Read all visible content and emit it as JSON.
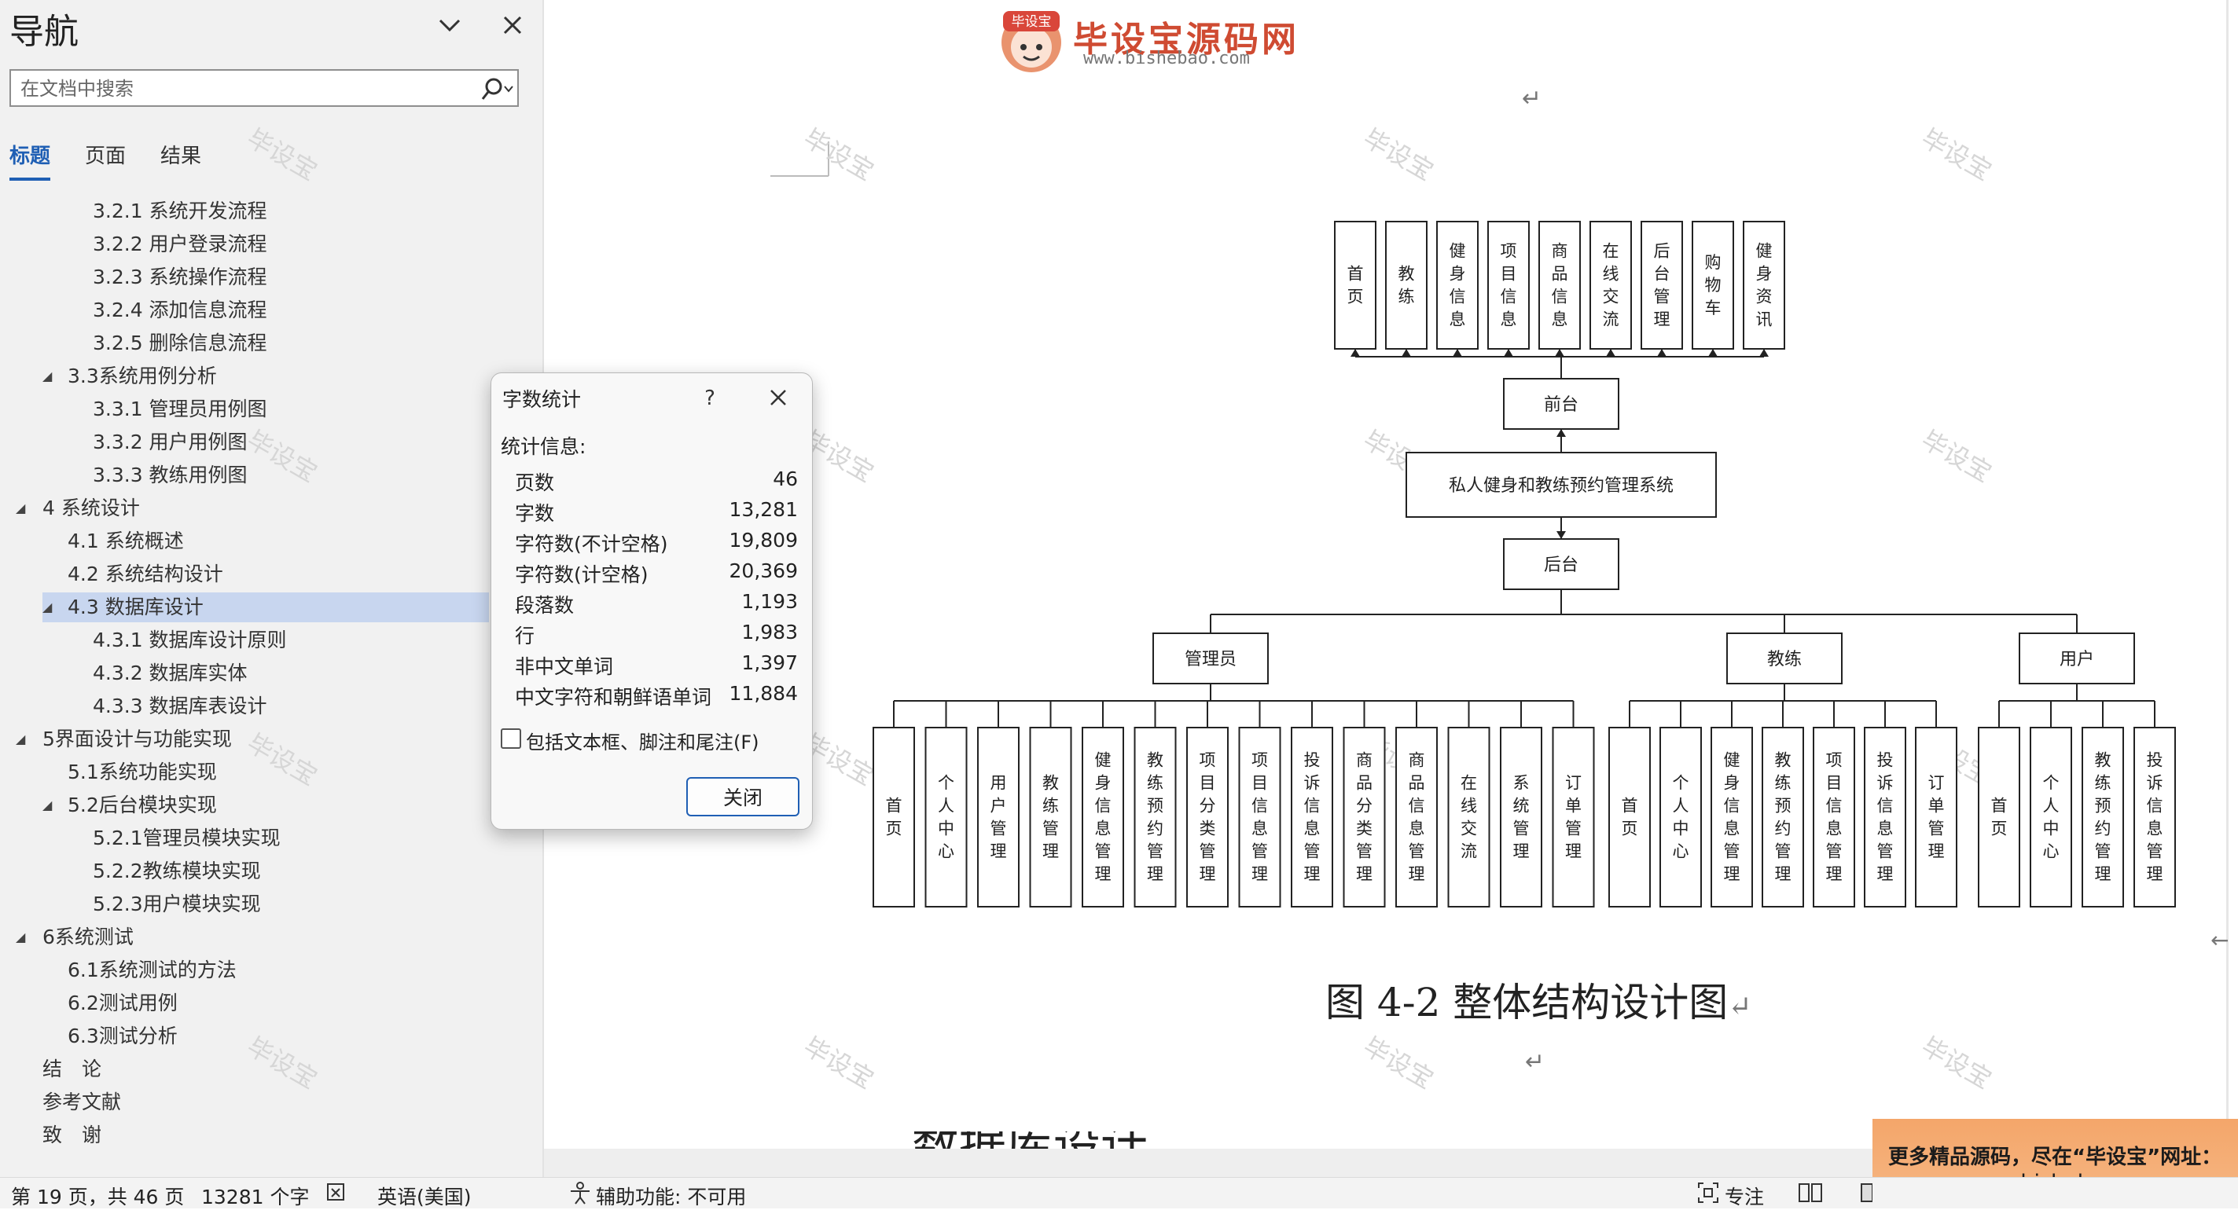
{
  "nav": {
    "title": "导航",
    "search_placeholder": "在文档中搜索",
    "tabs": [
      "标题",
      "页面",
      "结果"
    ],
    "tree": [
      {
        "label": "3.2.1 系统开发流程"
      },
      {
        "label": "3.2.2 用户登录流程"
      },
      {
        "label": "3.2.3 系统操作流程"
      },
      {
        "label": "3.2.4 添加信息流程"
      },
      {
        "label": "3.2.5 删除信息流程"
      },
      {
        "label": "3.3系统用例分析"
      },
      {
        "label": "3.3.1 管理员用例图"
      },
      {
        "label": "3.3.2 用户用例图"
      },
      {
        "label": "3.3.3 教练用例图"
      },
      {
        "label": "4 系统设计"
      },
      {
        "label": "4.1 系统概述"
      },
      {
        "label": "4.2 系统结构设计"
      },
      {
        "label": "4.3 数据库设计"
      },
      {
        "label": "4.3.1 数据库设计原则"
      },
      {
        "label": "4.3.2 数据库实体"
      },
      {
        "label": "4.3.3 数据库表设计"
      },
      {
        "label": "5界面设计与功能实现"
      },
      {
        "label": "5.1系统功能实现"
      },
      {
        "label": "5.2后台模块实现"
      },
      {
        "label": "5.2.1管理员模块实现"
      },
      {
        "label": "5.2.2教练模块实现"
      },
      {
        "label": "5.2.3用户模块实现"
      },
      {
        "label": "6系统测试"
      },
      {
        "label": "6.1系统测试的方法"
      },
      {
        "label": "6.2测试用例"
      },
      {
        "label": "6.3测试分析"
      },
      {
        "label": "结　论"
      },
      {
        "label": "参考文献"
      },
      {
        "label": "致　谢"
      }
    ]
  },
  "watermark": "毕设宝",
  "logo": {
    "name": "毕设宝源码网",
    "url": "www.bishebao.com",
    "badge": "毕设宝"
  },
  "dialog": {
    "title": "字数统计",
    "help": "?",
    "section": "统计信息:",
    "rows": [
      {
        "label": "页数",
        "value": "46"
      },
      {
        "label": "字数",
        "value": "13,281"
      },
      {
        "label": "字符数(不计空格)",
        "value": "19,809"
      },
      {
        "label": "字符数(计空格)",
        "value": "20,369"
      },
      {
        "label": "段落数",
        "value": "1,193"
      },
      {
        "label": "行",
        "value": "1,983"
      },
      {
        "label": "非中文单词",
        "value": "1,397"
      },
      {
        "label": "中文字符和朝鲜语单词",
        "value": "11,884"
      }
    ],
    "checkbox_label": "包括文本框、脚注和尾注(F)",
    "checkbox_checked": false,
    "close_label": "关闭"
  },
  "diagram": {
    "top_modules": [
      "首页",
      "教练",
      "健身信息",
      "项目信息",
      "商品信息",
      "在线交流",
      "后台管理",
      "购物车",
      "健身资讯"
    ],
    "frontend": "前台",
    "system": "私人健身和教练预约管理系统",
    "backend": "后台",
    "roles": [
      {
        "name": "管理员",
        "modules": [
          "首页",
          "个人中心",
          "用户管理",
          "教练管理",
          "健身信息管理",
          "教练预约管理",
          "项目分类管理",
          "项目信息管理",
          "投诉信息管理",
          "商品分类管理",
          "商品信息管理",
          "在线交流",
          "系统管理",
          "订单管理"
        ]
      },
      {
        "name": "教练",
        "modules": [
          "首页",
          "个人中心",
          "健身信息管理",
          "教练预约管理",
          "项目信息管理",
          "投诉信息管理",
          "订单管理"
        ]
      },
      {
        "name": "用户",
        "modules": [
          "首页",
          "个人中心",
          "教练预约管理",
          "投诉信息管理"
        ]
      }
    ]
  },
  "figure_caption": "图 4-2  整体结构设计图",
  "next_heading": "数据库设计",
  "ad": {
    "line1": "更多精品源码，尽在“毕设宝”网址：",
    "line2": "www.bishebao.com"
  },
  "status": {
    "page": "第 19 页，共 46 页",
    "words": "13281 个字",
    "language": "英语(美国)",
    "accessibility": "辅助功能: 不可用",
    "focus": "专注"
  }
}
